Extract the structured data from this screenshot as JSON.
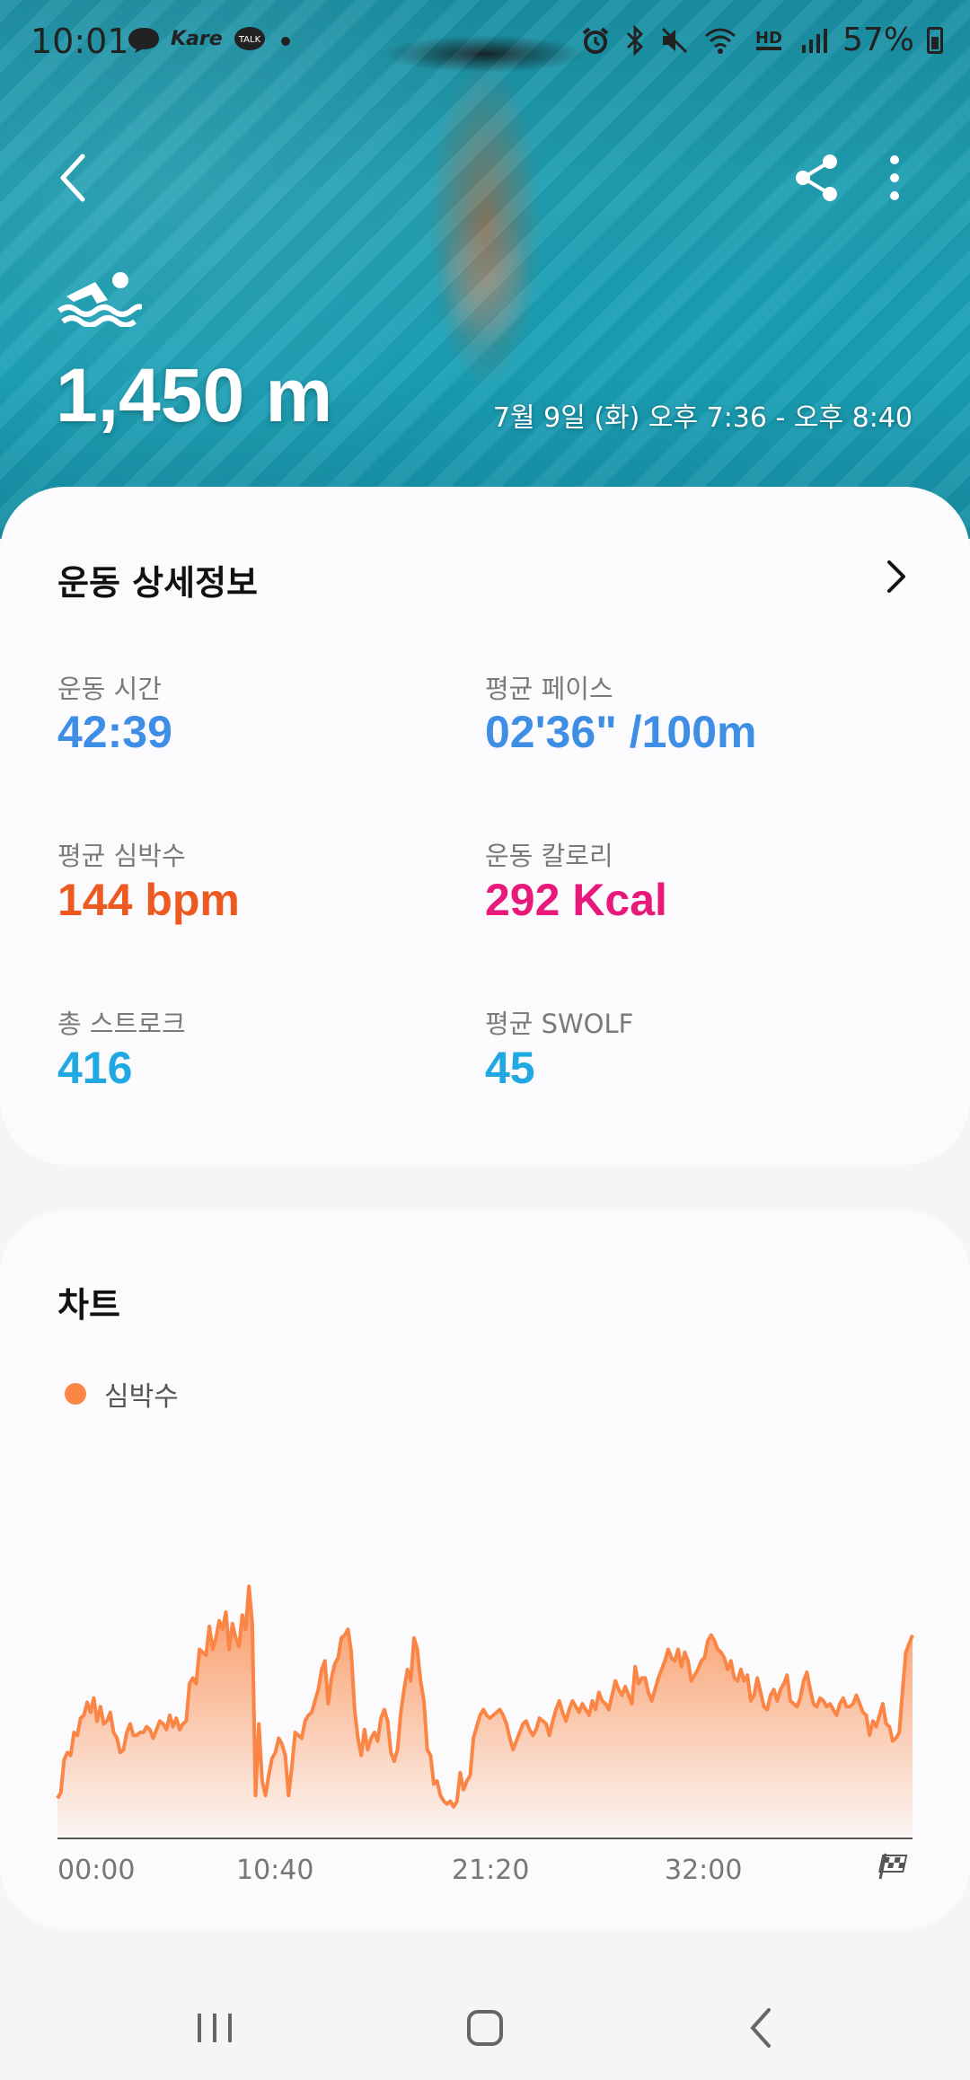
{
  "status": {
    "time": "10:01",
    "left_icons": [
      "chat-bubble-icon",
      "kare-icon",
      "kakaotalk-icon",
      "dot-icon"
    ],
    "right_icons": [
      "alarm-icon",
      "bluetooth-icon",
      "mute-icon",
      "wifi-icon",
      "hd-voice-icon",
      "signal-icon"
    ],
    "kare_text": "Kare",
    "talk_text": "TALK",
    "hd_text": "HD",
    "battery": "57%"
  },
  "hero": {
    "distance": "1,450 m",
    "datetime": "7월 9일 (화) 오후 7:36 - 오후 8:40"
  },
  "details": {
    "title": "운동 상세정보",
    "metrics": [
      {
        "label": "운동 시간",
        "value": "42:39",
        "color": "#3f8ee6"
      },
      {
        "label": "평균 페이스",
        "value": "02'36\" /100m",
        "color": "#3f8ee6"
      },
      {
        "label": "평균 심박수",
        "value": "144 bpm",
        "color": "#ec5a22"
      },
      {
        "label": "운동 칼로리",
        "value": "292 Kcal",
        "color": "#e8197a"
      },
      {
        "label": "총 스트로크",
        "value": "416",
        "color": "#1fa8e2"
      },
      {
        "label": "평균 SWOLF",
        "value": "45",
        "color": "#1fa8e2"
      }
    ]
  },
  "chart": {
    "title": "차트",
    "legend": "심박수",
    "color": "#fa8544"
  },
  "chart_data": {
    "type": "area",
    "series": [
      {
        "name": "심박수",
        "values": [
          28,
          32,
          55,
          60,
          58,
          74,
          72,
          84,
          86,
          95,
          88,
          98,
          82,
          92,
          80,
          82,
          88,
          74,
          70,
          60,
          62,
          74,
          80,
          72,
          72,
          74,
          74,
          78,
          76,
          70,
          76,
          82,
          80,
          76,
          86,
          78,
          84,
          76,
          80,
          82,
          108,
          112,
          108,
          132,
          130,
          128,
          148,
          132,
          140,
          152,
          146,
          158,
          132,
          150,
          140,
          134,
          156,
          146,
          176,
          150,
          30,
          80,
          40,
          30,
          44,
          56,
          60,
          70,
          66,
          58,
          30,
          50,
          74,
          72,
          70,
          82,
          86,
          88,
          96,
          104,
          118,
          124,
          94,
          112,
          122,
          126,
          140,
          142,
          146,
          130,
          90,
          70,
          58,
          76,
          62,
          70,
          74,
          68,
          84,
          90,
          82,
          60,
          54,
          62,
          88,
          104,
          118,
          110,
          140,
          132,
          110,
          96,
          62,
          58,
          38,
          40,
          30,
          26,
          24,
          26,
          22,
          26,
          46,
          34,
          40,
          44,
          70,
          78,
          86,
          90,
          86,
          84,
          86,
          88,
          90,
          86,
          80,
          70,
          62,
          68,
          74,
          80,
          82,
          76,
          72,
          76,
          84,
          82,
          80,
          72,
          82,
          90,
          96,
          88,
          82,
          90,
          96,
          92,
          88,
          94,
          90,
          86,
          96,
          90,
          102,
          96,
          94,
          90,
          100,
          110,
          104,
          100,
          106,
          100,
          94,
          120,
          108,
          112,
          112,
          102,
          96,
          104,
          112,
          118,
          124,
          132,
          126,
          124,
          132,
          120,
          130,
          124,
          110,
          114,
          118,
          124,
          126,
          138,
          142,
          138,
          132,
          130,
          126,
          118,
          124,
          112,
          110,
          118,
          110,
          114,
          96,
          100,
          112,
          102,
          92,
          90,
          100,
          104,
          96,
          104,
          108,
          114,
          96,
          94,
          92,
          98,
          110,
          116,
          104,
          94,
          92,
          98,
          96,
          92,
          94,
          90,
          86,
          94,
          98,
          92,
          92,
          94,
          100,
          94,
          88,
          86,
          72,
          82,
          78,
          86,
          94,
          80,
          78,
          68,
          70,
          74,
          104,
          130,
          136,
          142
        ]
      }
    ],
    "x_ticks": [
      "00:00",
      "10:40",
      "21:20",
      "32:00"
    ],
    "grid": false,
    "legend_position": "top-left"
  },
  "nav": {
    "buttons": [
      "recent-apps",
      "home",
      "back"
    ]
  }
}
